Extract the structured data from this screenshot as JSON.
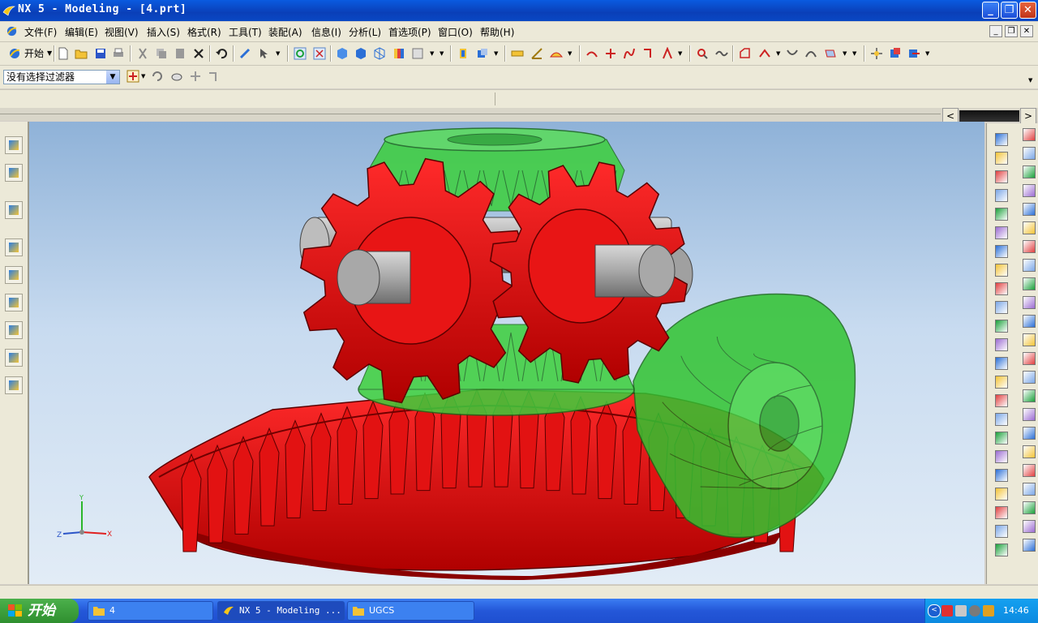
{
  "window": {
    "title": "NX 5 - Modeling - [4.prt]",
    "controls": {
      "minimize": "_",
      "restore": "❐",
      "close": "✕"
    }
  },
  "menu": {
    "items": [
      "文件(F)",
      "编辑(E)",
      "视图(V)",
      "插入(S)",
      "格式(R)",
      "工具(T)",
      "装配(A)",
      "信息(I)",
      "分析(L)",
      "首选项(P)",
      "窗口(O)",
      "帮助(H)"
    ],
    "mdi_controls": [
      "_",
      "❐",
      "✕"
    ]
  },
  "toolbar": {
    "start_label": "开始",
    "selection_filter": "没有选择过滤器"
  },
  "viewport": {
    "background_top": "#8fb2d8",
    "background_bottom": "#e2ecf6",
    "gear_red": "#e01010",
    "gear_green": "#2fc92f",
    "shaft_gray": "#9a9a9a",
    "triad": {
      "x_label": "X",
      "y_label": "Y",
      "z_label": "Z"
    }
  },
  "statusbar": {
    "text": ""
  },
  "taskbar": {
    "start_label": "开始",
    "tasks": [
      {
        "label": "4",
        "icon": "folder-icon"
      },
      {
        "label": "NX 5 - Modeling ...",
        "icon": "nx-icon"
      },
      {
        "label": "UGCS",
        "icon": "folder-icon"
      }
    ],
    "clock": "14:46"
  }
}
